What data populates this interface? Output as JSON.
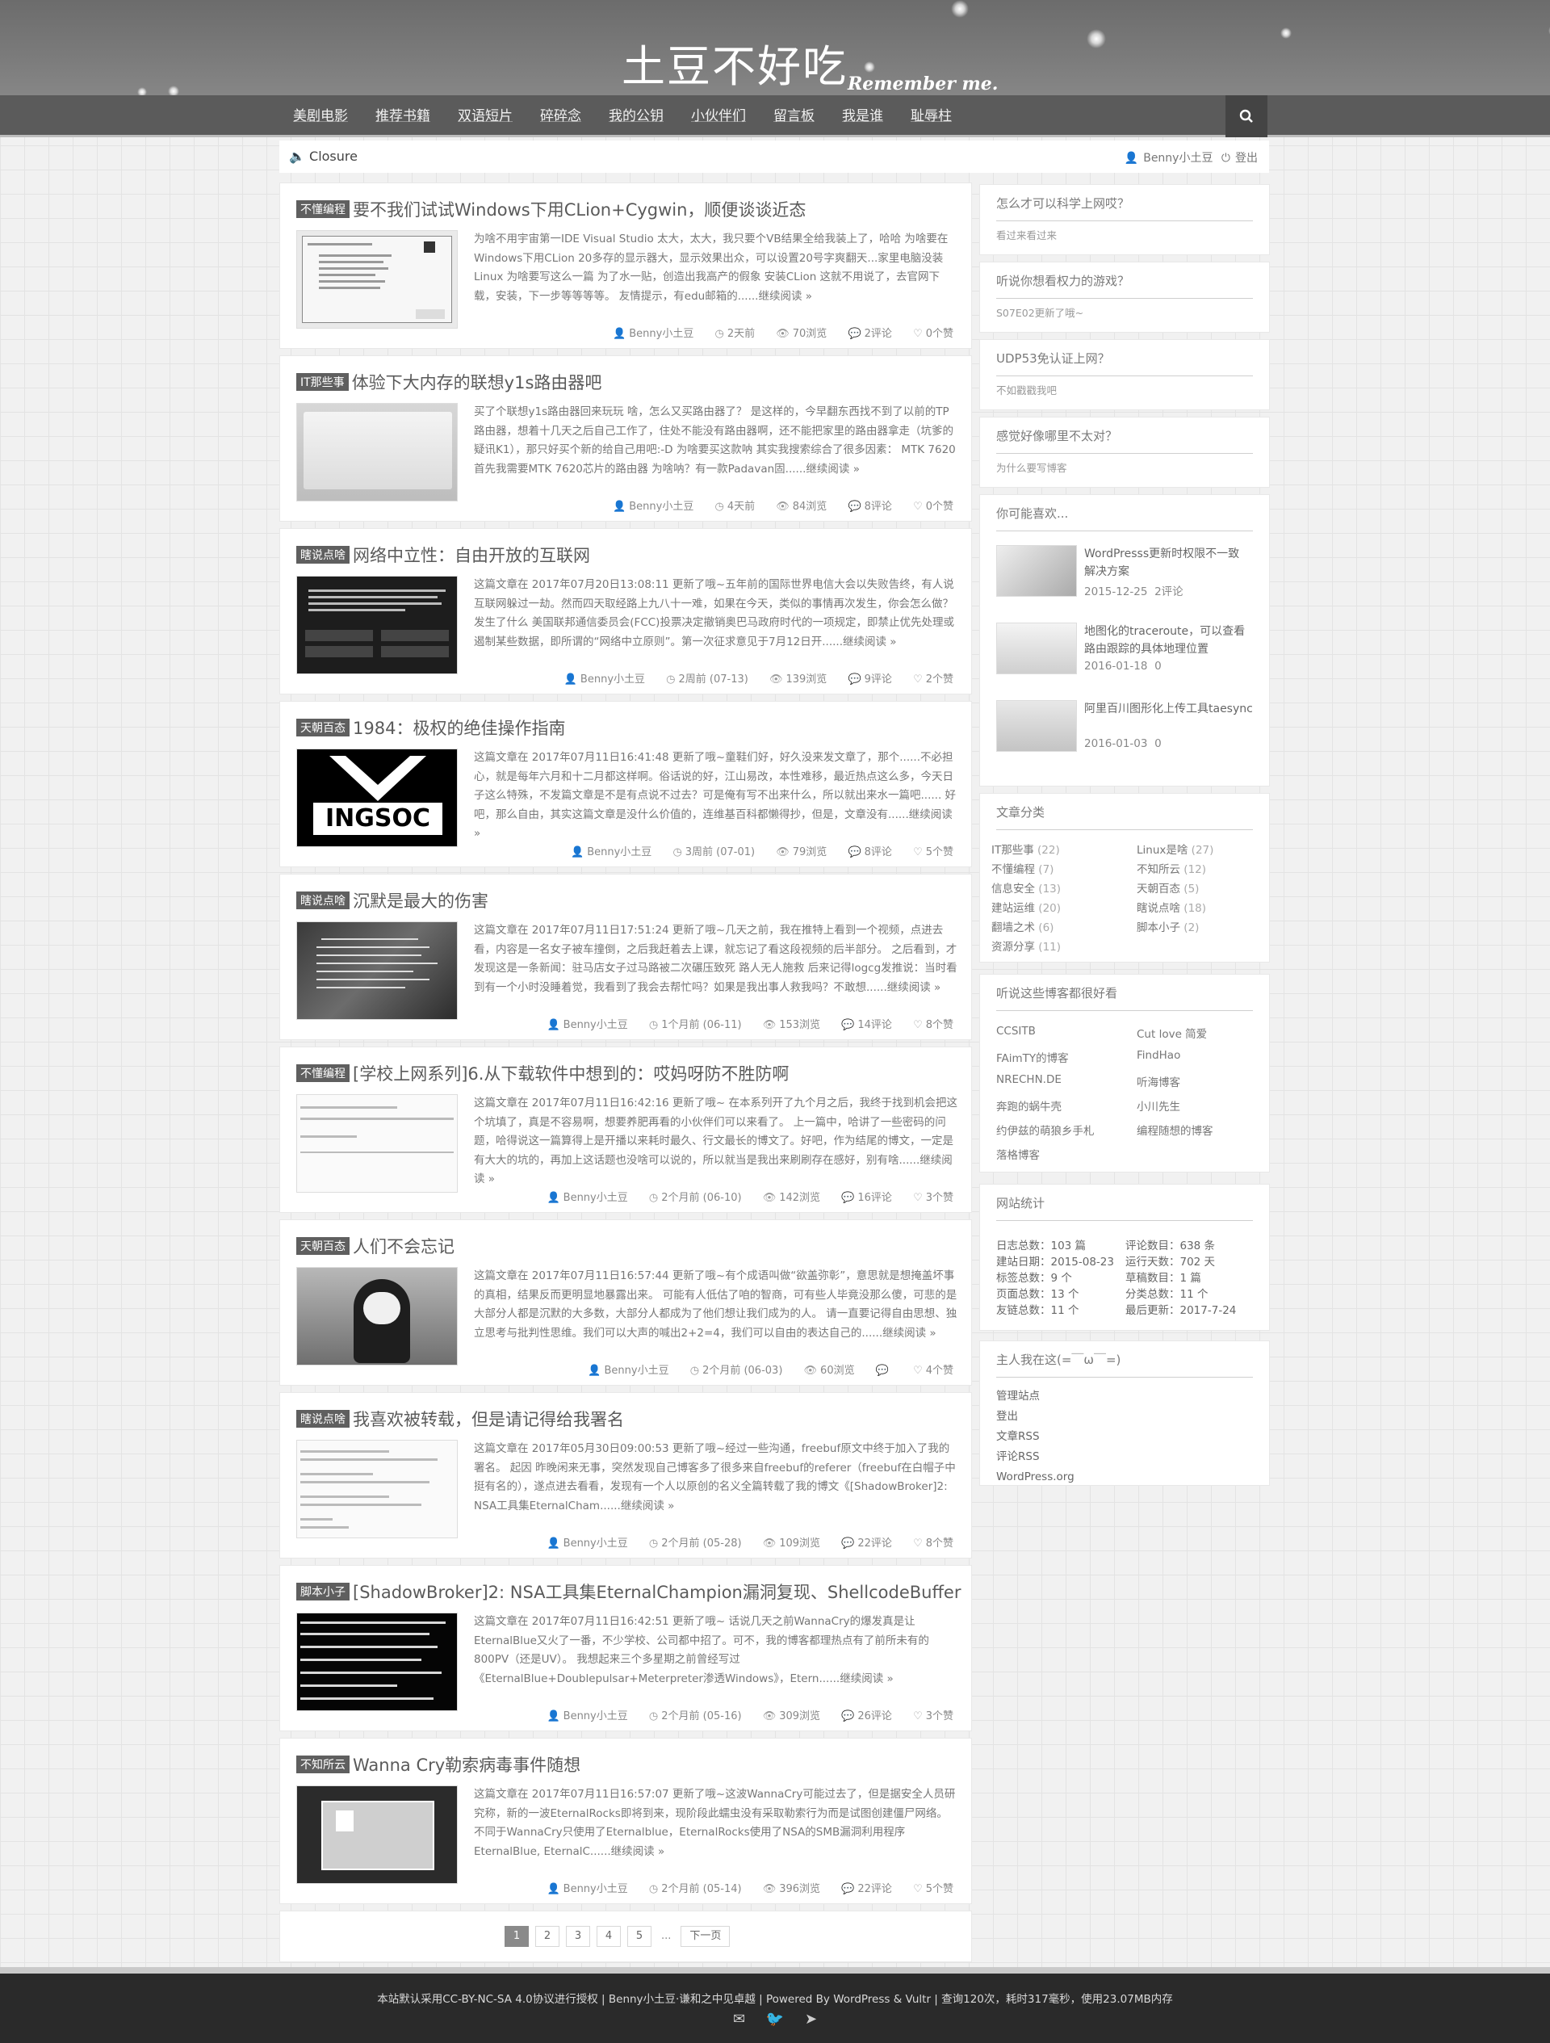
{
  "site": {
    "title": "土豆不好吃",
    "subtitle": "Remember me."
  },
  "nav": {
    "items": [
      "美剧电影",
      "推荐书籍",
      "双语短片",
      "碎碎念",
      "我的公钥",
      "小伙伴们",
      "留言板",
      "我是谁",
      "耻辱柱"
    ],
    "search_icon": "search-icon"
  },
  "notice": {
    "speaker_icon": "speaker-icon",
    "text": "Closure",
    "user": "Benny小土豆",
    "logout": "登出"
  },
  "posts": [
    {
      "category": "不懂编程",
      "title": "要不我们试试Windows下用CLion+Cygwin，顺便谈谈近态",
      "excerpt": "为啥不用宇宙第一IDE Visual Studio 太大，太大，我只要个VB结果全给我装上了，哈哈 为啥要在Windows下用CLion 20多存的显示器大，显示效果出众，可以设置20号字爽翻天...家里电脑没装Linux 为啥要写这么一篇 为了水一贴，创造出我高产的假象 安装CLion 这就不用说了，去官网下载，安装，下一步等等等等。 友情提示，有edu邮箱的......继续阅读 »",
      "author": "Benny小土豆",
      "time": "2天前",
      "views": "70浏览",
      "comments": "2评论",
      "likes": "0个赞"
    },
    {
      "category": "IT那些事",
      "title": "体验下大内存的联想y1s路由器吧",
      "excerpt": "买了个联想y1s路由器回来玩玩 啥，怎么又买路由器了？ 是这样的，今早翻东西找不到了以前的TP路由器，想着十几天之后自己工作了，住处不能没有路由器啊，还不能把家里的路由器拿走（坑爹的疑讯K1），那只好买个新的给自己用吧:-D 为啥要买这款呐 其实我搜索综合了很多因素： MTK 7620 首先我需要MTK 7620芯片的路由器 为啥呐？有一款Padavan固......继续阅读 »",
      "author": "Benny小土豆",
      "time": "4天前",
      "views": "84浏览",
      "comments": "8评论",
      "likes": "0个赞"
    },
    {
      "category": "瞎说点啥",
      "title": "网络中立性：自由开放的互联网",
      "excerpt": "这篇文章在 2017年07月20日13:08:11 更新了哦~五年前的国际世界电信大会以失败告终，有人说互联网躲过一劫。然而四天取经路上九八十一难，如果在今天，类似的事情再次发生，你会怎么做？ 发生了什么 美国联邦通信委员会(FCC)投票决定撤销奥巴马政府时代的一项规定，即禁止优先处理或遏制某些数据，即所谓的“网络中立原则”。第一次征求意见于7月12日开......继续阅读 »",
      "author": "Benny小土豆",
      "time": "2周前 (07-13)",
      "views": "139浏览",
      "comments": "9评论",
      "likes": "2个赞"
    },
    {
      "category": "天朝百态",
      "title": "1984：极权的绝佳操作指南",
      "excerpt": "这篇文章在 2017年07月11日16:41:48 更新了哦~童鞋们好，好久没来发文章了，那个......不必担心，就是每年六月和十二月都这样啊。俗话说的好，江山易改，本性难移，最近热点这么多，今天日子这么特殊，不发篇文章是不是有点说不过去？可是俺有写不出来什么，所以就出来水一篇吧...... 好吧，那么自由，其实这篇文章是没什么价值的，连维基百科都懒得抄，但是，文章没有......继续阅读 »",
      "author": "Benny小土豆",
      "time": "3周前 (07-01)",
      "views": "79浏览",
      "comments": "8评论",
      "likes": "5个赞"
    },
    {
      "category": "瞎说点啥",
      "title": "沉默是最大的伤害",
      "excerpt": "这篇文章在 2017年07月11日17:51:24 更新了哦~几天之前，我在推特上看到一个视频，点进去看，内容是一名女子被车撞倒，之后我赶着去上课，就忘记了看这段视频的后半部分。 之后看到，才发现这是一条新闻：驻马店女子过马路被二次碾压致死 路人无人施救 后来记得logcg发推说：当时看到有一个小时没睡着觉，我看到了我会去帮忙吗？如果是我出事人救我吗？不敢想......继续阅读 »",
      "author": "Benny小土豆",
      "time": "1个月前 (06-11)",
      "views": "153浏览",
      "comments": "14评论",
      "likes": "8个赞"
    },
    {
      "category": "不懂编程",
      "title": "[学校上网系列]6.从下载软件中想到的：哎妈呀防不胜防啊",
      "excerpt": "这篇文章在 2017年07月11日16:42:16 更新了哦~ 在本系列开了九个月之后，我终于找到机会把这个坑填了，真是不容易啊，想要养肥再看的小伙伴们可以来看了。 上一篇中，哈讲了一些密码的问题，哈得说这一篇算得上是开播以来耗时最久、行文最长的博文了。好吧，作为结尾的博文，一定是有大大的坑的，再加上这话题也没啥可以说的，所以就当是我出来刷刷存在感好，别有啥......继续阅读 »",
      "author": "Benny小土豆",
      "time": "2个月前 (06-10)",
      "views": "142浏览",
      "comments": "16评论",
      "likes": "3个赞"
    },
    {
      "category": "天朝百态",
      "title": "人们不会忘记",
      "excerpt": "这篇文章在 2017年07月11日16:57:44 更新了哦~有个成语叫做“欲盖弥彰”，意思就是想掩盖坏事的真相，结果反而更明显地暴露出来。 可能有人低估了咱的智商，可有些人毕竟没那么傻，可悲的是大部分人都是沉默的大多数，大部分人都成为了他们想让我们成为的人。 请一直要记得自由思想、独立思考与批判性思维。我们可以大声的喊出2+2=4，我们可以自由的表达自己的......继续阅读 »",
      "author": "Benny小土豆",
      "time": "2个月前 (06-03)",
      "views": "60浏览",
      "comments": "",
      "likes": "4个赞"
    },
    {
      "category": "瞎说点啥",
      "title": "我喜欢被转载，但是请记得给我署名",
      "excerpt": "这篇文章在 2017年05月30日09:00:53 更新了哦~经过一些沟通，freebuf原文中终于加入了我的署名。 起因 昨晚闲来无事，突然发现自己博客多了很多来自freebuf的referer（freebuf在白帽子中挺有名的），遂点进去看看，发现有一个人以原创的名义全篇转载了我的博文《[ShadowBroker]2: NSA工具集EternalCham......继续阅读 »",
      "author": "Benny小土豆",
      "time": "2个月前 (05-28)",
      "views": "109浏览",
      "comments": "22评论",
      "likes": "8个赞"
    },
    {
      "category": "脚本小子",
      "title": "[ShadowBroker]2: NSA工具集EternalChampion漏洞复现、ShellcodeBuffer",
      "excerpt": "这篇文章在 2017年07月11日16:42:51 更新了哦~ 话说几天之前WannaCry的爆发真是让EternalBlue又火了一番，不少学校、公司都中招了。可不，我的博客都理热点有了前所未有的800PV（还是UV）。 我想起来三个多星期之前曾经写过《EternalBlue+Doublepulsar+Meterpreter渗透Windows》，Etern......继续阅读 »",
      "author": "Benny小土豆",
      "time": "2个月前 (05-16)",
      "views": "309浏览",
      "comments": "26评论",
      "likes": "3个赞"
    },
    {
      "category": "不知所云",
      "title": "Wanna Cry勒索病毒事件随想",
      "excerpt": "这篇文章在 2017年07月11日16:57:07 更新了哦~这波WannaCry可能过去了，但是据安全人员研究称，新的一波EternalRocks即将到来，现阶段此蠕虫没有采取勒索行为而是试图创建僵尸网络。不同于WannaCry只使用了Eternalblue，EternalRocks使用了NSA的SMB漏洞利用程序EternalBlue, EternalC......继续阅读 »",
      "author": "Benny小土豆",
      "time": "2个月前 (05-14)",
      "views": "396浏览",
      "comments": "22评论",
      "likes": "5个赞"
    }
  ],
  "pagination": {
    "pages": [
      "1",
      "2",
      "3",
      "4",
      "5"
    ],
    "ellipsis": "...",
    "next": "下一页"
  },
  "sidebar": {
    "faq": [
      {
        "title": "怎么才可以科学上网哎？",
        "sub": "看过来看过来"
      },
      {
        "title": "听说你想看权力的游戏？",
        "sub": "S07E02更新了哦~"
      },
      {
        "title": "UDP53免认证上网？",
        "sub": "不如戳戳我吧"
      },
      {
        "title": "感觉好像哪里不太对？",
        "sub": "为什么要写博客"
      }
    ],
    "popular": {
      "title": "你可能喜欢...",
      "items": [
        {
          "title": "WordPresss更新时权限不一致 解决方案",
          "date": "2015-12-25",
          "comments": "2评论"
        },
        {
          "title": "地图化的traceroute，可以查看路由跟踪的具体地理位置",
          "date": "2016-01-18",
          "comments": "0"
        },
        {
          "title": "阿里百川图形化上传工具taesync",
          "date": "2016-01-03",
          "comments": "0"
        }
      ]
    },
    "categories": {
      "title": "文章分类",
      "items": [
        {
          "name": "IT那些事",
          "count": "(22)"
        },
        {
          "name": "Linux是啥",
          "count": "(27)"
        },
        {
          "name": "不懂编程",
          "count": "(7)"
        },
        {
          "name": "不知所云",
          "count": "(12)"
        },
        {
          "name": "信息安全",
          "count": "(13)"
        },
        {
          "name": "天朝百态",
          "count": "(5)"
        },
        {
          "name": "建站运维",
          "count": "(20)"
        },
        {
          "name": "瞎说点啥",
          "count": "(18)"
        },
        {
          "name": "翻墙之术",
          "count": "(6)"
        },
        {
          "name": "脚本小子",
          "count": "(2)"
        },
        {
          "name": "资源分享",
          "count": "(11)"
        }
      ]
    },
    "blogroll": {
      "title": "听说这些博客都很好看",
      "items": [
        "CCSITB",
        "Cut love 简爱",
        "FAimTY的博客",
        "FindHao",
        "NRECHN.DE",
        "听海博客",
        "奔跑的蜗牛壳",
        "小川先生",
        "约伊兹的萌狼乡手札",
        "编程随想的博客",
        "落格博客"
      ]
    },
    "stats": {
      "title": "网站统计",
      "items": [
        "日志总数：103 篇",
        "评论数目：638 条",
        "建站日期：2015-08-23",
        "运行天数：702 天",
        "标签总数：9 个",
        "草稿数目：1 篇",
        "页面总数：13 个",
        "分类总数：11 个",
        "友链总数：11 个",
        "最后更新：2017-7-24"
      ]
    },
    "admin": {
      "title": "主人我在这(=￣ω￣=)",
      "links": [
        "管理站点",
        "登出",
        "文章RSS",
        "评论RSS",
        "WordPress.org"
      ]
    }
  },
  "footer": {
    "copyright": "本站默认采用CC-BY-NC-SA 4.0协议进行授权 | Benny小土豆·谦和之中见卓越 | Powered By WordPress & Vultr | 查询120次，耗时317毫秒，使用23.07MB内存",
    "icons": [
      "mail-icon",
      "twitter-icon",
      "telegram-icon"
    ]
  },
  "colors": {
    "banner": "#777777",
    "navbar": "#5b5b5b",
    "footer": "#2a2a2a",
    "category_badge": "#5f5f5f"
  }
}
